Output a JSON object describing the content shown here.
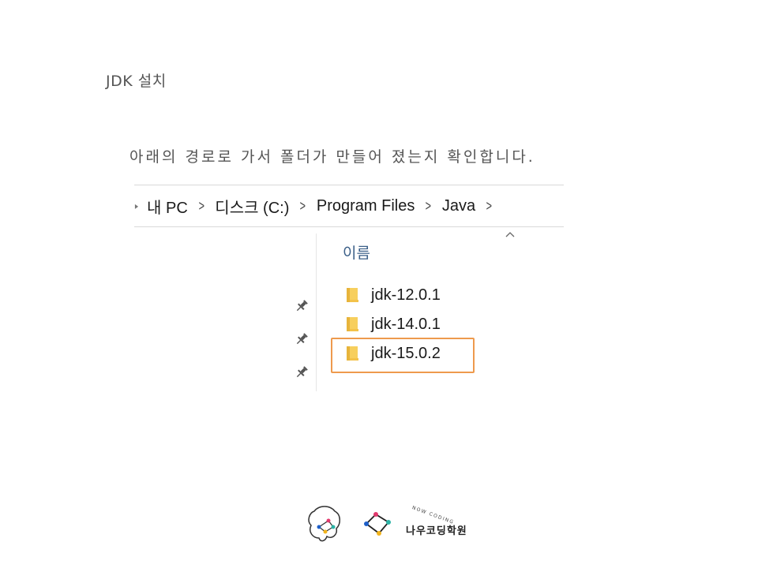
{
  "slide": {
    "title": "JDK 설치",
    "instruction": "아래의 경로로 가서 폴더가 만들어 졌는지 확인합니다."
  },
  "explorer": {
    "breadcrumb": [
      "내 PC",
      "디스크 (C:)",
      "Program Files",
      "Java"
    ],
    "column_header": "이름",
    "folders": [
      {
        "name": "jdk-12.0.1",
        "highlighted": false
      },
      {
        "name": "jdk-14.0.1",
        "highlighted": false
      },
      {
        "name": "jdk-15.0.2",
        "highlighted": true
      }
    ],
    "highlight_color": "#ee9a4d",
    "folder_color": "#f7cf5d",
    "icons": [
      "pin-icon",
      "folder-icon",
      "chevron-right-icon",
      "sort-caret-icon"
    ]
  },
  "footer": {
    "brand_name": "나우코딩학원",
    "brand_sub": "NOW CODING"
  }
}
